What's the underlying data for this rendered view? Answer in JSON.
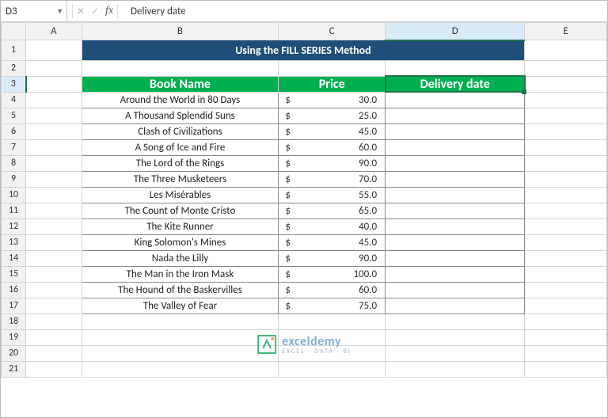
{
  "name_box": {
    "value": "D3"
  },
  "formula_bar": {
    "fx": "fx",
    "value": "Delivery date"
  },
  "columns": [
    "A",
    "B",
    "C",
    "D",
    "E"
  ],
  "row_numbers": [
    "1",
    "2",
    "3",
    "4",
    "5",
    "6",
    "7",
    "8",
    "9",
    "10",
    "11",
    "12",
    "13",
    "14",
    "15",
    "16",
    "17",
    "18",
    "19",
    "20",
    "21"
  ],
  "selected": {
    "col": "D",
    "row": "3"
  },
  "banner": "Using the FILL SERIES Method",
  "headers": {
    "book": "Book Name",
    "price": "Price",
    "delivery": "Delivery date"
  },
  "chart_data": {
    "type": "table",
    "title": "Using the FILL SERIES Method",
    "columns": [
      "Book Name",
      "Price",
      "Delivery date"
    ],
    "rows": [
      {
        "book": "Around the World in 80 Days",
        "price": "30.0",
        "delivery": ""
      },
      {
        "book": "A Thousand Splendid Suns",
        "price": "25.0",
        "delivery": ""
      },
      {
        "book": "Clash of Civilizations",
        "price": "45.0",
        "delivery": ""
      },
      {
        "book": "A Song of Ice and Fire",
        "price": "60.0",
        "delivery": ""
      },
      {
        "book": "The Lord of the Rings",
        "price": "90.0",
        "delivery": ""
      },
      {
        "book": "The Three Musketeers",
        "price": "70.0",
        "delivery": ""
      },
      {
        "book": "Les Misérables",
        "price": "55.0",
        "delivery": ""
      },
      {
        "book": "The Count of Monte Cristo",
        "price": "65.0",
        "delivery": ""
      },
      {
        "book": "The Kite Runner",
        "price": "40.0",
        "delivery": ""
      },
      {
        "book": "King Solomon's Mines",
        "price": "45.0",
        "delivery": ""
      },
      {
        "book": "Nada the Lilly",
        "price": "90.0",
        "delivery": ""
      },
      {
        "book": "The Man in the Iron Mask",
        "price": "100.0",
        "delivery": ""
      },
      {
        "book": "The Hound of the Baskervilles",
        "price": "60.0",
        "delivery": ""
      },
      {
        "book": "The Valley of Fear",
        "price": "75.0",
        "delivery": ""
      }
    ],
    "currency_symbol": "$"
  },
  "watermark": {
    "brand": "exceldemy",
    "sub": "EXCEL · DATA · BI"
  }
}
